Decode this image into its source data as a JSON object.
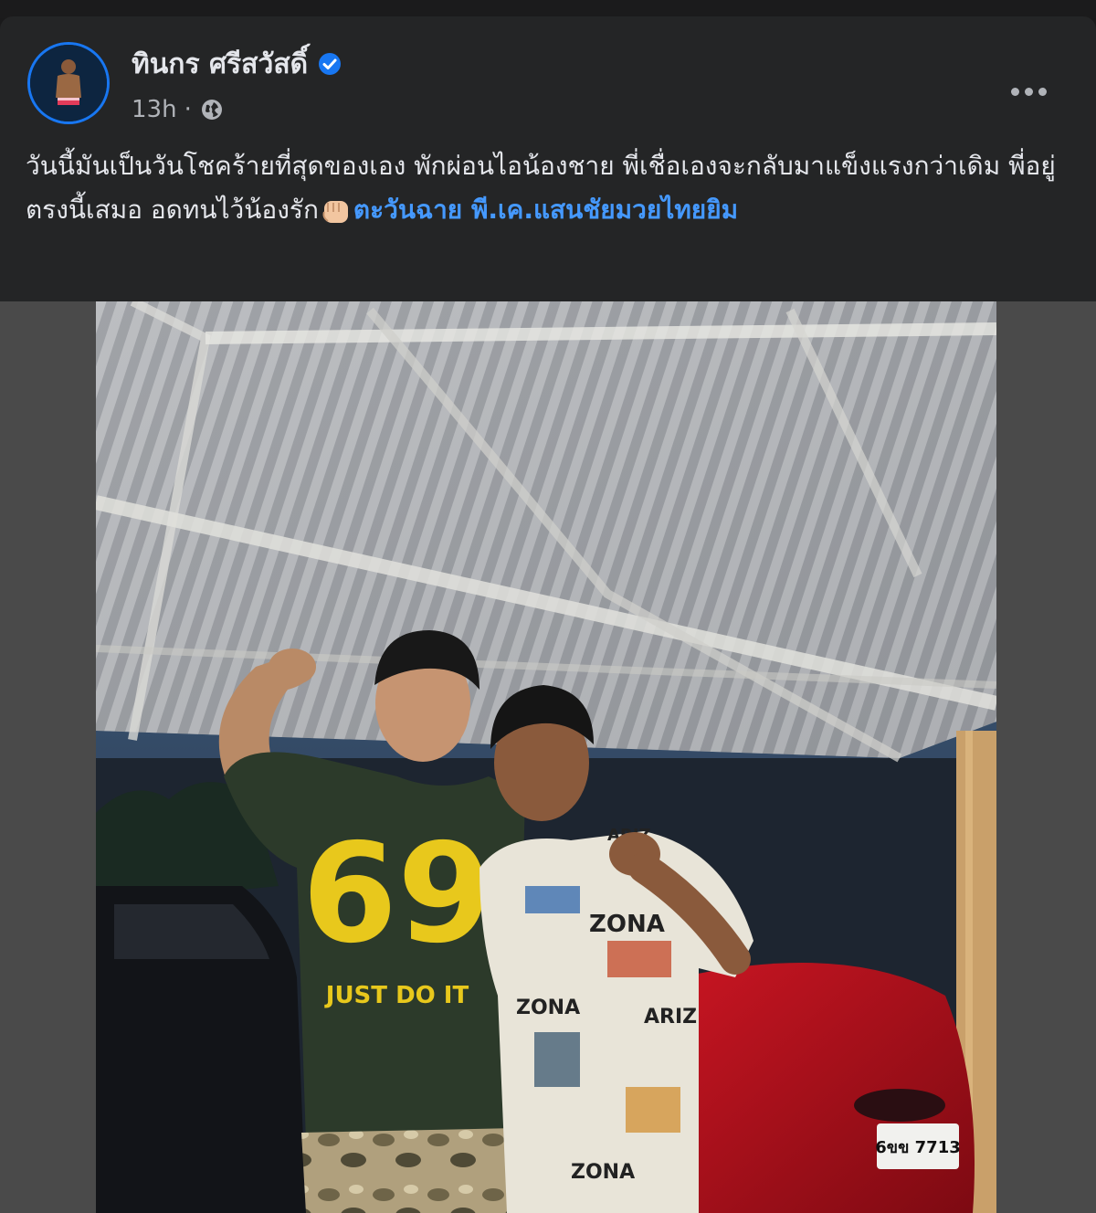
{
  "post": {
    "author_name": "ทินกร ศรีสวัสดิ์",
    "timestamp": "13h",
    "separator": "·",
    "privacy_icon": "globe-icon",
    "verified_icon": "verified-badge-icon",
    "more_icon": "more-options-icon",
    "caption_text": "วันนี้มันเป็นวันโชคร้ายที่สุดของเอง พักผ่อนไอน้องชาย พี่เชื่อเองจะกลับมาแข็งแรงกว่าเดิม พี่อยู่ตรงนี้เสมอ อดทนไว้น้องรัก",
    "caption_emoji": "fist-emoji",
    "tags": [
      "ตะวันฉาย พี.เค.แสนชัยมวยไทยยิม"
    ],
    "image": {
      "shirt_number": "69",
      "shirt_slogan": "JUST DO IT",
      "shirt_print_words": [
        "ARIZ",
        "ZONA",
        "ARIZ",
        "ZONA",
        "ZONA"
      ],
      "license_plate": "6ขข 7713"
    }
  },
  "colors": {
    "card_bg": "#242526",
    "text_primary": "#e4e6eb",
    "text_secondary": "#b0b3b8",
    "link": "#4599ff",
    "verified": "#1877f2"
  }
}
